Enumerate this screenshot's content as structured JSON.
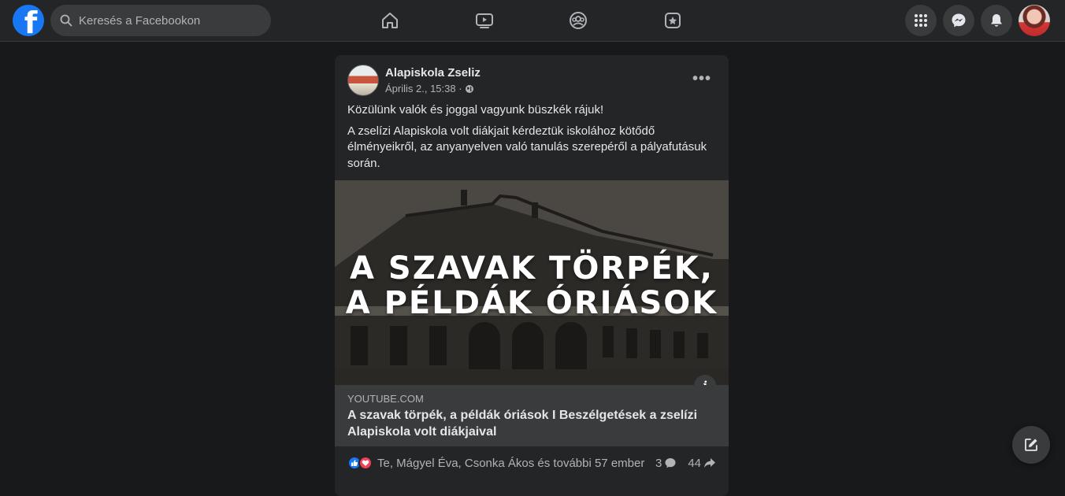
{
  "topbar": {
    "search_placeholder": "Keresés a Facebookon",
    "logo_glyph": "f",
    "nav_icons": [
      "home-icon",
      "watch-icon",
      "groups-icon",
      "gaming-icon"
    ],
    "right_icons": [
      "menu-grid-icon",
      "messenger-icon",
      "notifications-icon"
    ]
  },
  "post": {
    "author": "Alapiskola Zseliz",
    "date": "Április 2., 15:38 ·",
    "more": "•••",
    "text": [
      "Közülünk valók és joggal vagyunk büszkék rájuk!",
      "A zselízi Alapiskola volt diákjait kérdeztük iskolához kötődő élményeikről, az anyanyelven való tanulás szerepéről a pályafutásuk során."
    ],
    "hero_title_line1": "A SZAVAK TÖRPÉK,",
    "hero_title_line2": "A PÉLDÁK ÓRIÁSOK",
    "info_label": "i",
    "link_domain": "YOUTUBE.COM",
    "link_title": "A szavak törpék, a példák óriások I Beszélgetések a zselízi Alapiskola volt diákjaival",
    "reactions_text": "Te, Mágyel Éva, Csonka Ákos és további 57 ember",
    "comments_count": "3",
    "shares_count": "44"
  },
  "colors": {
    "background": "#18191a",
    "surface": "#242526",
    "surface_alt": "#3a3b3c",
    "text_primary": "#e4e6eb",
    "text_secondary": "#b0b3b8",
    "brand": "#1877f2",
    "love": "#f33e58"
  }
}
